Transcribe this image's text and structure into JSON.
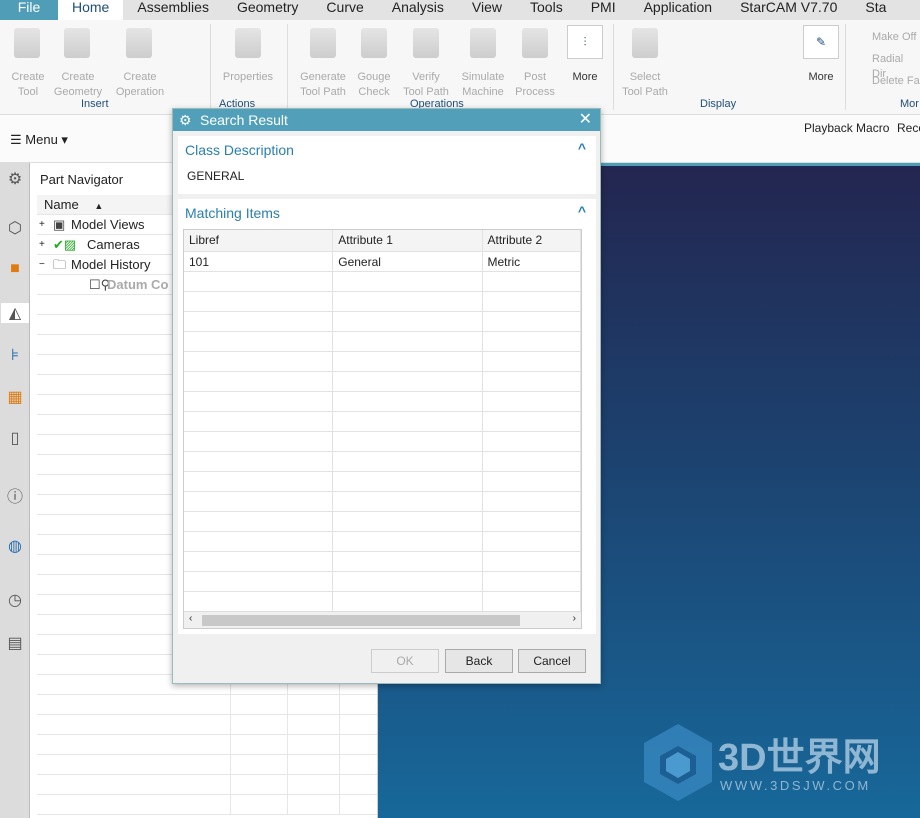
{
  "tabs": [
    "File",
    "Home",
    "Assemblies",
    "Geometry",
    "Curve",
    "Analysis",
    "View",
    "Tools",
    "PMI",
    "Application",
    "StarCAM V7.70",
    "Sta"
  ],
  "ribbon": {
    "insert": {
      "create_tool": "Create\nTool",
      "create_geometry": "Create\nGeometry",
      "create_operation": "Create\nOperation",
      "label": "Insert"
    },
    "actions": {
      "properties": "Properties",
      "label": "Actions"
    },
    "operations": {
      "generate": "Generate\nTool Path",
      "gouge": "Gouge\nCheck",
      "verify": "Verify\nTool Path",
      "simulate": "Simulate\nMachine",
      "post": "Post\nProcess",
      "more": "More",
      "label": "Operations"
    },
    "display": {
      "select": "Select\nTool Path",
      "more": "More",
      "label": "Display"
    },
    "more_group": {
      "make_off": "Make Off",
      "radial": "Radial Dir",
      "delete": "Delete Fa",
      "label": "Mor"
    }
  },
  "toolbar": {
    "menu": "Menu",
    "playback_macro": "Playback Macro",
    "record": "Reco"
  },
  "navigator": {
    "title": "Part Navigator",
    "column": "Name",
    "items": [
      {
        "label": "Model Views",
        "exp": "+"
      },
      {
        "label": "Cameras",
        "exp": "+"
      },
      {
        "label": "Model History",
        "exp": "−"
      },
      {
        "label": "Datum Co",
        "exp": ""
      }
    ]
  },
  "dialog": {
    "title": "Search Result",
    "class_section": "Class Description",
    "class_value": "GENERAL",
    "matching_section": "Matching Items",
    "columns": [
      "Libref",
      "Attribute 1",
      "Attribute 2"
    ],
    "rows": [
      [
        "101",
        "General",
        "Metric"
      ]
    ],
    "ok": "OK",
    "back": "Back",
    "cancel": "Cancel"
  },
  "watermark": {
    "name": "3D世界网",
    "url": "WWW.3DSJW.COM"
  }
}
